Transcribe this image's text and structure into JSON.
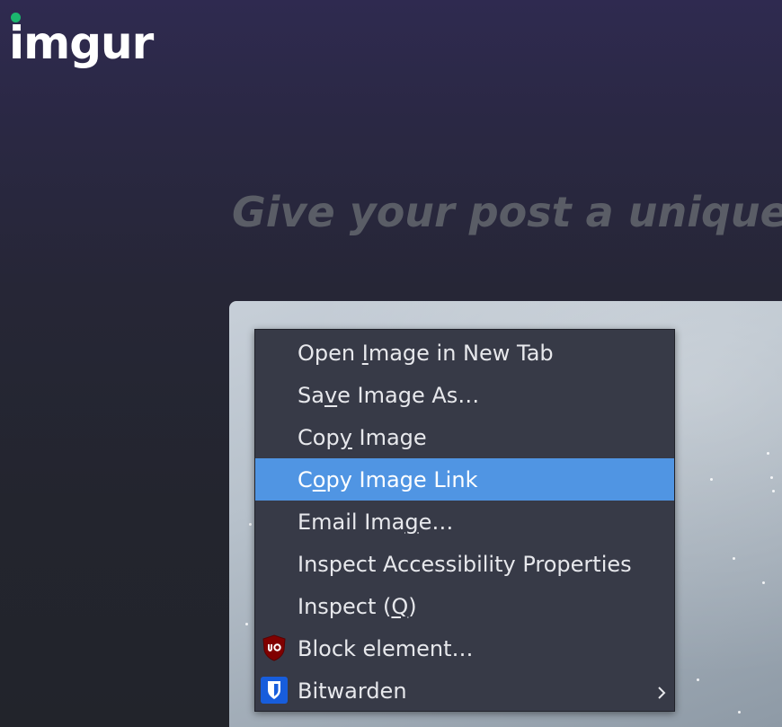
{
  "header": {
    "logo_text": "imgur",
    "brand_color": "#1bb76e"
  },
  "main": {
    "headline": "Give your post a unique"
  },
  "context_menu": {
    "highlight_color": "#5095e3",
    "items": [
      {
        "pre": "Open ",
        "key": "I",
        "post": "mage in New Tab",
        "highlighted": false
      },
      {
        "pre": "Sa",
        "key": "v",
        "post": "e Image As…",
        "highlighted": false
      },
      {
        "pre": "Cop",
        "key": "y",
        "post": " Image",
        "highlighted": false
      },
      {
        "pre": "C",
        "key": "o",
        "post": "py Image Link",
        "highlighted": true
      },
      {
        "pre": "Email Ima",
        "key": "g",
        "post": "e…",
        "highlighted": false
      },
      {
        "pre": "Inspect Accessibility Properties",
        "key": "",
        "post": "",
        "highlighted": false
      },
      {
        "pre": "Inspect (",
        "key": "Q",
        "post": ")",
        "highlighted": false
      },
      {
        "pre": "Block element…",
        "key": "",
        "post": "",
        "icon": "ublock-origin-icon",
        "highlighted": false
      },
      {
        "pre": "Bitwarden",
        "key": "",
        "post": "",
        "icon": "bitwarden-shield-icon",
        "submenu": true,
        "highlighted": false
      }
    ]
  }
}
